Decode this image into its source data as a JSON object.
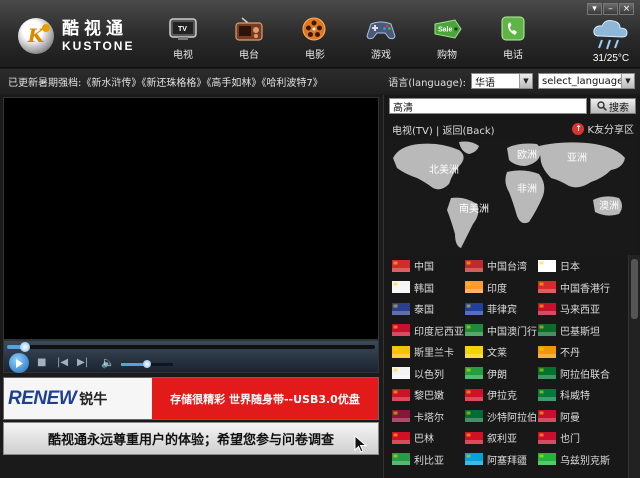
{
  "app": {
    "logo_mark": "K",
    "name_cn": "酷视通",
    "name_en": "KUSTONE"
  },
  "nav": [
    {
      "label": "电视",
      "icon": "tv-icon"
    },
    {
      "label": "电台",
      "icon": "radio-icon"
    },
    {
      "label": "电影",
      "icon": "film-reel-icon"
    },
    {
      "label": "游戏",
      "icon": "gamepad-icon"
    },
    {
      "label": "购物",
      "icon": "shopping-sale-icon"
    },
    {
      "label": "电话",
      "icon": "phone-icon"
    }
  ],
  "window_controls": {
    "menu": "▾",
    "minimize": "–",
    "close": "×"
  },
  "weather": {
    "temperature": "31/25°C",
    "icon": "rain-cloud-icon"
  },
  "info_bar": {
    "updates_text": "已更新暑期强档:《新水浒传》《新还珠格格》《高手如林》《哈利波特7》",
    "language_label": "语言(language):",
    "language_value": "华语",
    "select_language_value": "select_language"
  },
  "player": {
    "progress_fraction": 0.04,
    "volume_fraction": 0.5
  },
  "ad": {
    "brand_en": "RENEW",
    "brand_cn": "锐牛",
    "slogan": "存储很精彩 世界随身带--USB3.0优盘"
  },
  "survey": {
    "text": "酷视通永远尊重用户的体验；希望您参与问卷调查"
  },
  "right_panel": {
    "search_value": "高清",
    "search_button": "搜索",
    "sublink_tv": "电视(TV)",
    "sublink_sep": " | ",
    "sublink_back": "返回(Back)",
    "share_label": "K友分享区",
    "map_labels": [
      "北美洲",
      "欧洲",
      "亚洲",
      "非洲",
      "南美洲",
      "澳洲"
    ]
  },
  "countries": [
    [
      "中国",
      "中国台湾",
      "日本"
    ],
    [
      "韩国",
      "印度",
      "中国香港行"
    ],
    [
      "泰国",
      "菲律宾",
      "马来西亚"
    ],
    [
      "印度尼西亚",
      "中国澳门行",
      "巴基斯坦"
    ],
    [
      "斯里兰卡",
      "文莱",
      "不丹"
    ],
    [
      "以色列",
      "伊朗",
      "阿拉伯联合"
    ],
    [
      "黎巴嫩",
      "伊拉克",
      "科威特"
    ],
    [
      "卡塔尔",
      "沙特阿拉伯",
      "阿曼"
    ],
    [
      "巴林",
      "叙利亚",
      "也门"
    ],
    [
      "利比亚",
      "阿塞拜疆",
      "乌兹别克斯"
    ]
  ],
  "colors": {
    "accent_red": "#e21a1a",
    "brand_blue": "#1d3f96",
    "background": "#1b1b1b"
  }
}
